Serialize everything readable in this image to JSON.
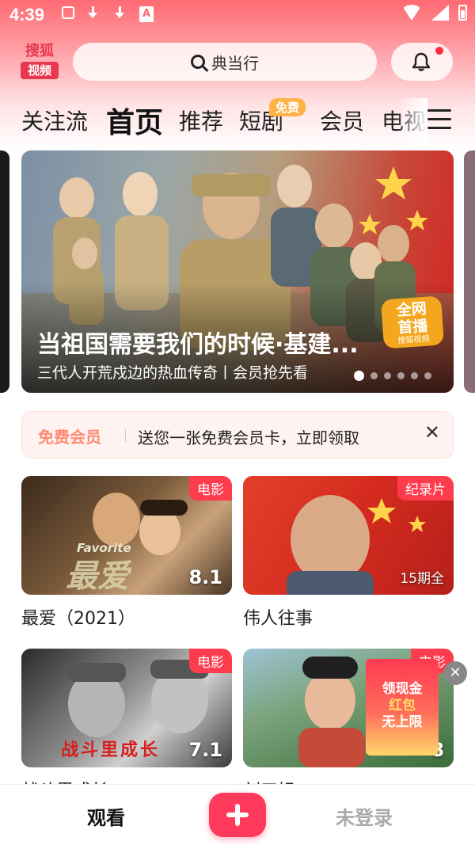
{
  "status_bar": {
    "time": "4:39"
  },
  "header": {
    "logo_top": "搜狐",
    "logo_bottom": "视频",
    "search_text": "典当行"
  },
  "tabs": [
    {
      "label": "关注流"
    },
    {
      "label": "首页"
    },
    {
      "label": "推荐"
    },
    {
      "label": "短剧",
      "badge": "免费"
    },
    {
      "label": "会员"
    },
    {
      "label": "电视"
    }
  ],
  "banner": {
    "title": "当祖国需要我们的时候·基建...",
    "subtitle": "三代人开荒戍边的热血传奇丨会员抢先看",
    "badge_main": "全网首播",
    "badge_small": "搜狐视频",
    "dot_count": 6,
    "active_dot": 0
  },
  "promo": {
    "label": "免费会员",
    "text": "送您一张免费会员卡，立即领取",
    "close": "✕"
  },
  "cards": [
    {
      "tag": "电影",
      "rating": "8.1",
      "title": "最爱（2021）",
      "overlay_en": "Favorite",
      "overlay_cn": "最爱"
    },
    {
      "tag": "纪录片",
      "episodes": "15期全",
      "title": "伟人往事"
    },
    {
      "tag": "电影",
      "rating": "7.1",
      "title": "战斗里成长",
      "overlay_cn": "战斗里成长"
    },
    {
      "tag": "电影",
      "rating": "8",
      "title": "刘三姐"
    }
  ],
  "ad": {
    "line1": "领现金",
    "line2": "红包",
    "line3": "无上限",
    "close": "✕"
  },
  "bottom_nav": {
    "watch": "观看",
    "login": "未登录"
  },
  "colors": {
    "accent": "#ff3a5c",
    "tag_red": "#ff3b4e",
    "promo_label": "#ff8a73"
  }
}
